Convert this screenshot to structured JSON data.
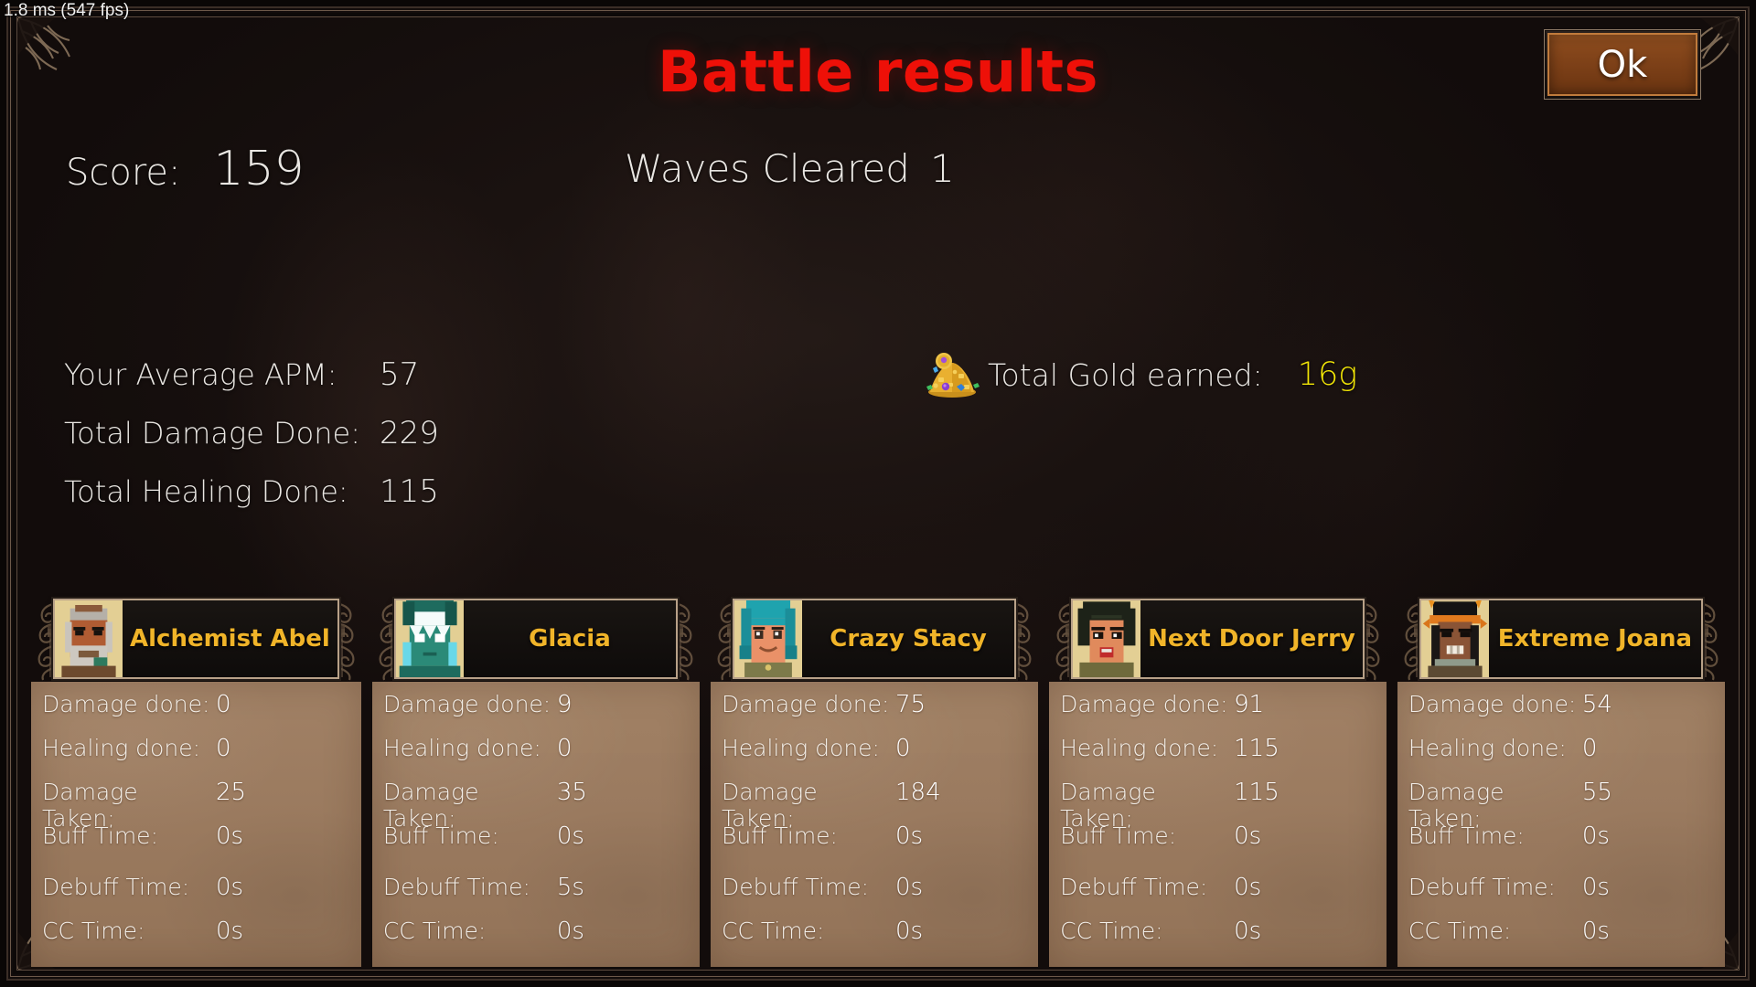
{
  "hud": {
    "fps_counter": "1.8 ms (547 fps)"
  },
  "header": {
    "title": "Battle results",
    "ok_label": "Ok",
    "title_color": "#ee1008"
  },
  "summary": {
    "score_label": "Score:",
    "score_value": "159",
    "waves_label": "Waves Cleared",
    "waves_value": "1",
    "rows": [
      {
        "label": "Your Average APM:",
        "value": "57"
      },
      {
        "label": "Total Damage Done:",
        "value": "229"
      },
      {
        "label": "Total Healing Done:",
        "value": "115"
      }
    ],
    "gold_label": "Total Gold earned:",
    "gold_value": "16g",
    "gold_color": "#f2e606",
    "gold_icon": "gold-pile-icon"
  },
  "stat_labels": {
    "damage_done": "Damage done:",
    "healing_done": "Healing done:",
    "damage_taken": "Damage Taken:",
    "buff_time": "Buff Time:",
    "debuff_time": "Debuff Time:",
    "cc_time": "CC Time:"
  },
  "cards": [
    {
      "name": "Alchemist Abel",
      "portrait": "portrait-alchemist-abel",
      "damage_done": "0",
      "healing_done": "0",
      "damage_taken": "25",
      "buff_time": "0s",
      "debuff_time": "0s",
      "cc_time": "0s"
    },
    {
      "name": "Glacia",
      "portrait": "portrait-glacia",
      "damage_done": "9",
      "healing_done": "0",
      "damage_taken": "35",
      "buff_time": "0s",
      "debuff_time": "5s",
      "cc_time": "0s"
    },
    {
      "name": "Crazy Stacy",
      "portrait": "portrait-crazy-stacy",
      "damage_done": "75",
      "healing_done": "0",
      "damage_taken": "184",
      "buff_time": "0s",
      "debuff_time": "0s",
      "cc_time": "0s"
    },
    {
      "name": "Next Door Jerry",
      "portrait": "portrait-next-door-jerry",
      "damage_done": "91",
      "healing_done": "115",
      "damage_taken": "115",
      "buff_time": "0s",
      "debuff_time": "0s",
      "cc_time": "0s"
    },
    {
      "name": "Extreme Joana",
      "portrait": "portrait-extreme-joana",
      "damage_done": "54",
      "healing_done": "0",
      "damage_taken": "55",
      "buff_time": "0s",
      "debuff_time": "0s",
      "cc_time": "0s"
    }
  ],
  "colors": {
    "card_name": "#f0b429",
    "card_body": "#9c7a5d",
    "button_fill": "#8a4a1d"
  }
}
